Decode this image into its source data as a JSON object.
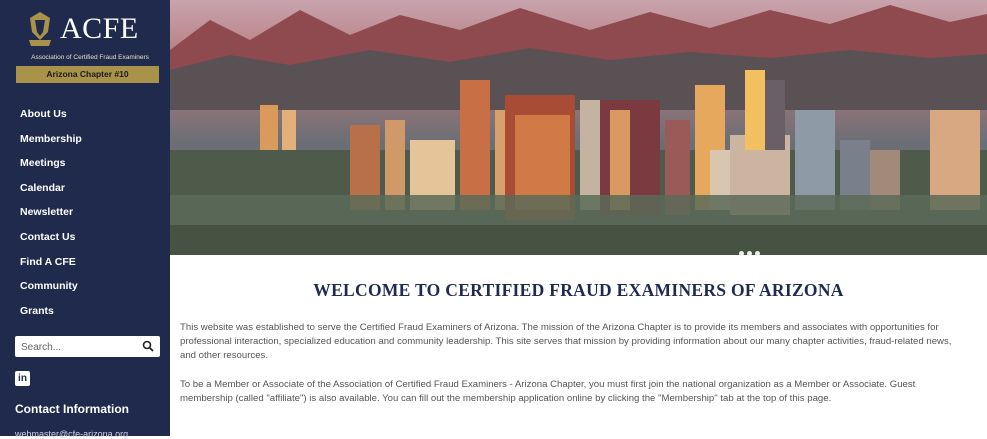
{
  "sidebar": {
    "logo_text": "ACFE",
    "logo_subtitle": "Association of Certified Fraud Examiners",
    "chapter": "Arizona Chapter #10",
    "nav": [
      {
        "label": "About Us"
      },
      {
        "label": "Membership"
      },
      {
        "label": "Meetings"
      },
      {
        "label": "Calendar"
      },
      {
        "label": "Newsletter"
      },
      {
        "label": "Contact Us"
      },
      {
        "label": "Find A CFE"
      },
      {
        "label": "Community"
      },
      {
        "label": "Grants"
      }
    ],
    "search_placeholder": "Search...",
    "linkedin": "in",
    "contact_title": "Contact Information",
    "contact_email": "webmaster@cfe-arizona.org"
  },
  "main": {
    "title": "WELCOME TO CERTIFIED FRAUD EXAMINERS OF ARIZONA",
    "paragraph1": "This website was established to serve the Certified Fraud Examiners of Arizona. The mission of the Arizona Chapter is to provide its members and associates with opportunities for professional interaction, specialized education and community leadership. This site serves that mission by providing information about our many chapter activities, fraud-related news, and other resources.",
    "paragraph2": "To be a Member or Associate of the Association of Certified Fraud Examiners - Arizona Chapter, you must first join the national organization as a Member or Associate. Guest membership (called \"affiliate\") is also available. You can fill out the membership application online by clicking the \"Membership\" tab at the top of this page."
  },
  "colors": {
    "sidebar_bg": "#1f2a4d",
    "badge_gold": "#a9924a",
    "title_navy": "#1e2a52"
  }
}
